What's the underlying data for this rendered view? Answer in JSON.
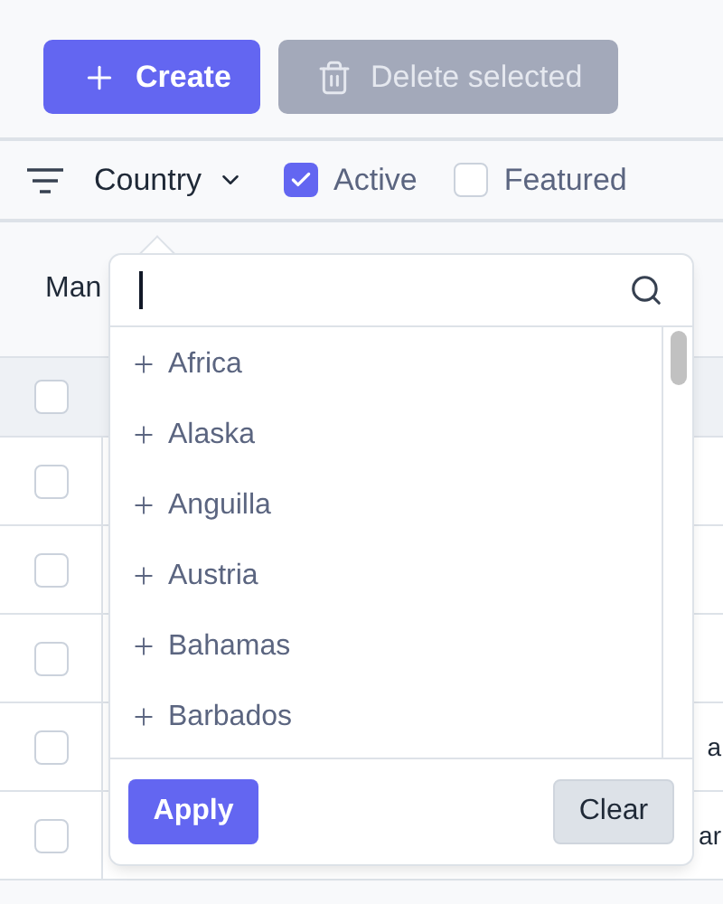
{
  "toolbar": {
    "buttons": [
      {
        "label": "Create",
        "kind": "create",
        "disabled": false
      },
      {
        "label": "Delete selected",
        "kind": "delete",
        "disabled": true
      }
    ]
  },
  "filters": {
    "dropdown": {
      "label": "Country",
      "expanded": true
    },
    "checkboxes": [
      {
        "label": "Active",
        "checked": true
      },
      {
        "label": "Featured",
        "checked": false
      }
    ]
  },
  "table": {
    "column_1": "Man",
    "header_checked": false,
    "rows": [
      {
        "checked": false
      },
      {
        "checked": false
      },
      {
        "checked": false
      },
      {
        "checked": false,
        "text": "a"
      },
      {
        "checked": false,
        "text": "ar"
      }
    ]
  },
  "popover": {
    "options": [
      "Africa",
      "Alaska",
      "Anguilla",
      "Austria",
      "Bahamas",
      "Barbados"
    ],
    "buttons": [
      {
        "label": "Apply",
        "kind": "primary"
      },
      {
        "label": "Clear",
        "kind": "secondary"
      }
    ]
  }
}
